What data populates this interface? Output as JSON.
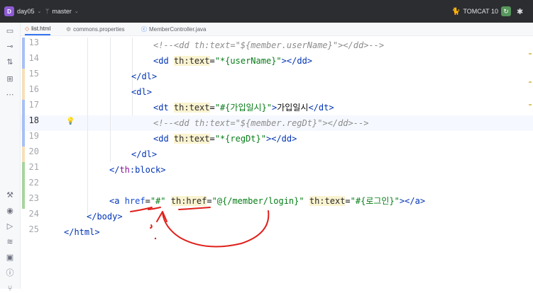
{
  "titlebar": {
    "project_badge": "D",
    "project_name": "day05",
    "branch_name": "master",
    "run_config": "TOMCAT 10"
  },
  "tabs": [
    {
      "label": "list.html",
      "icon": "html-file-icon"
    },
    {
      "label": "commons.properties",
      "icon": "properties-file-icon"
    },
    {
      "label": "MemberController.java",
      "icon": "java-class-icon"
    }
  ],
  "editor": {
    "lines": [
      {
        "num": "13",
        "text": "<!--<dd th:text=\"${member.userName}\"></dd>-->"
      },
      {
        "num": "14",
        "text": "<dd th:text=\"*{userName}\"></dd>"
      },
      {
        "num": "15",
        "text": "</dl>"
      },
      {
        "num": "16",
        "text": "<dl>"
      },
      {
        "num": "17",
        "text": "<dt th:text=\"#{가입일시}\">가입일시</dt>"
      },
      {
        "num": "18",
        "text": "<!--<dd th:text=\"${member.regDt}\"></dd>-->"
      },
      {
        "num": "19",
        "text": "<dd th:text=\"*{regDt}\"></dd>"
      },
      {
        "num": "20",
        "text": "</dl>"
      },
      {
        "num": "21",
        "text": "</th:block>"
      },
      {
        "num": "22",
        "text": ""
      },
      {
        "num": "23",
        "text": "<a href=\"#\" th:href=\"@{/member/login}\" th:text=\"#{로그인}\"></a>"
      },
      {
        "num": "24",
        "text": "</body>"
      },
      {
        "num": "25",
        "text": "</html>"
      }
    ]
  },
  "colors": {
    "titlebar_bg": "#2b2d30",
    "tag": "#0033b3",
    "string": "#067d17",
    "comment": "#8c8c8c",
    "annotation": "#e0201b",
    "vcs_modified": "#a9c0f5",
    "vcs_added": "#a7d4a0"
  }
}
